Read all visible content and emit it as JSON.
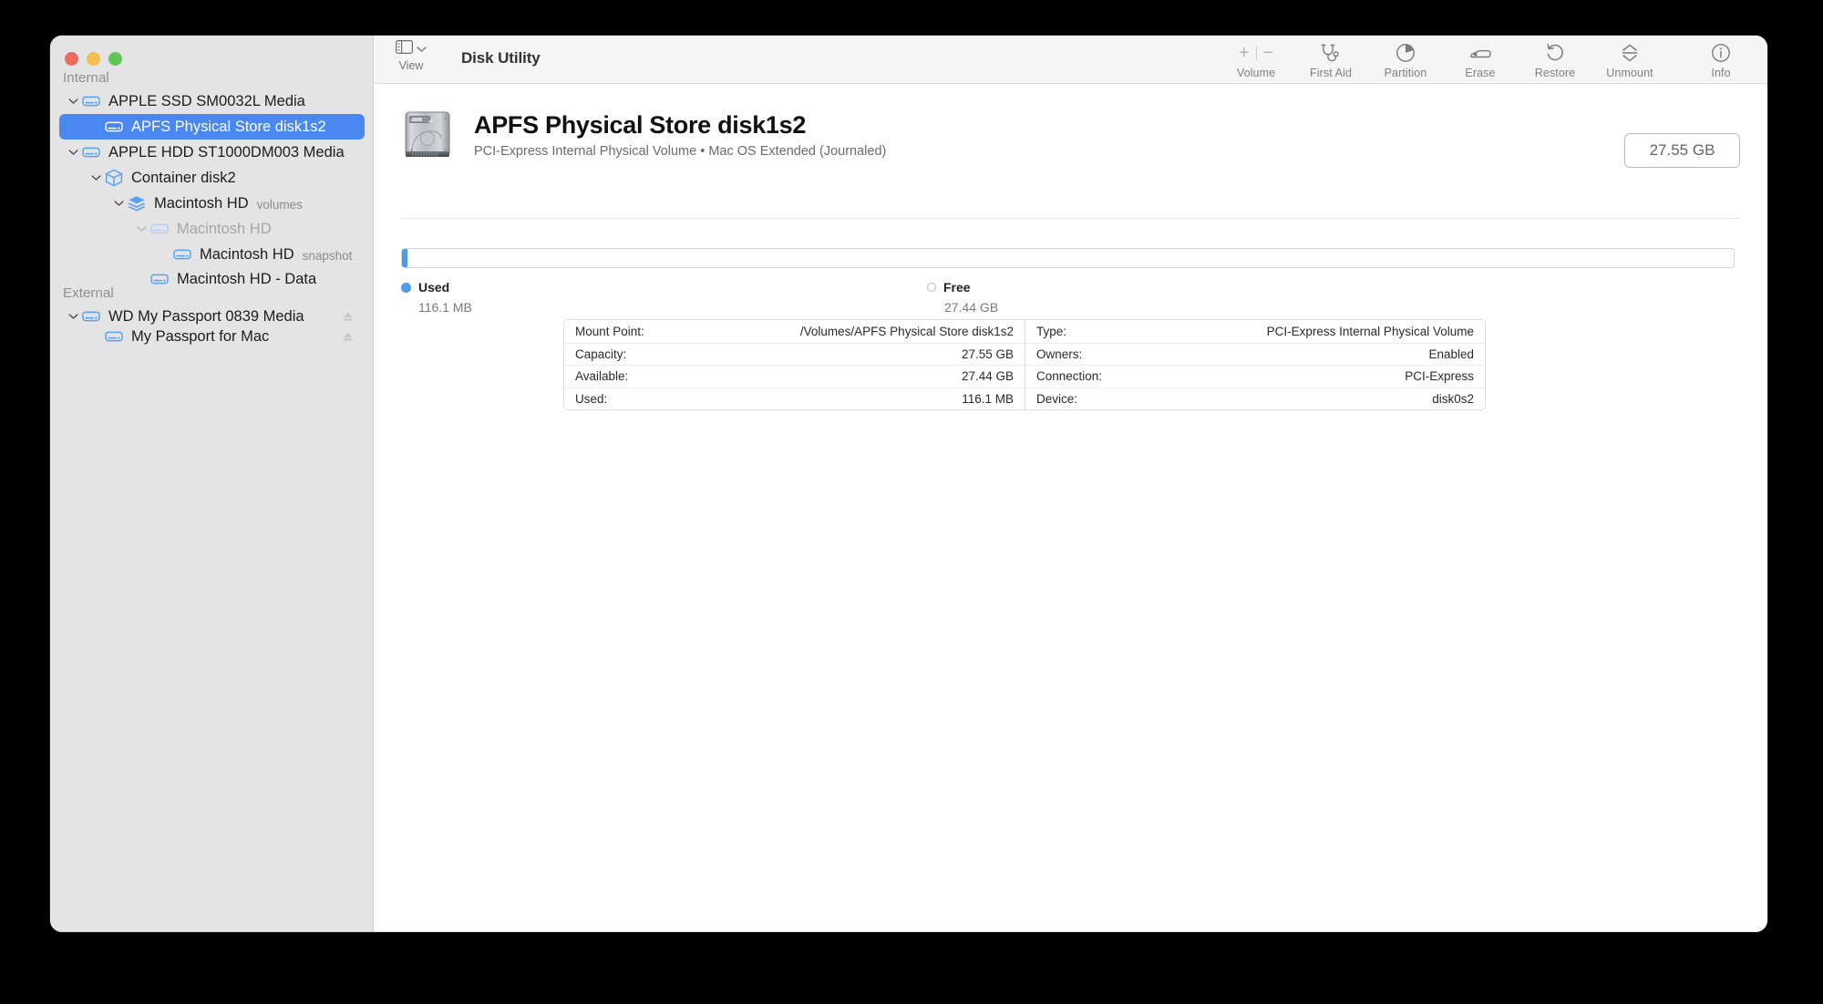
{
  "window": {
    "title": "Disk Utility",
    "traffic_lights": [
      "close",
      "minimize",
      "zoom"
    ]
  },
  "toolbar": {
    "view": {
      "label": "View",
      "icon": "sidebar-toggle-icon"
    },
    "items": [
      {
        "id": "volume",
        "label": "Volume",
        "icon": "plus-minus-icon",
        "disabled": true
      },
      {
        "id": "first-aid",
        "label": "First Aid",
        "icon": "stethoscope-icon",
        "disabled": false
      },
      {
        "id": "partition",
        "label": "Partition",
        "icon": "pie-chart-icon",
        "disabled": false
      },
      {
        "id": "erase",
        "label": "Erase",
        "icon": "eraser-icon",
        "disabled": false
      },
      {
        "id": "restore",
        "label": "Restore",
        "icon": "undo-arrow-icon",
        "disabled": false
      },
      {
        "id": "unmount",
        "label": "Unmount",
        "icon": "eject-split-icon",
        "disabled": false
      },
      {
        "id": "info",
        "label": "Info",
        "icon": "info-circle-icon",
        "disabled": false
      }
    ]
  },
  "sidebar": {
    "sections": [
      {
        "id": "internal",
        "label": "Internal"
      },
      {
        "id": "external",
        "label": "External"
      }
    ],
    "items": [
      {
        "id": "apple-ssd-media",
        "label": "APPLE SSD SM0032L Media",
        "sub": "",
        "icon": "disk-icon",
        "depth": 0,
        "twisty": "down",
        "selected": false,
        "dim": false,
        "eject": false
      },
      {
        "id": "apfs-physical-store",
        "label": "APFS Physical Store disk1s2",
        "sub": "",
        "icon": "disk-icon",
        "depth": 1,
        "twisty": "none",
        "selected": true,
        "dim": false,
        "eject": false
      },
      {
        "id": "apple-hdd-media",
        "label": "APPLE HDD ST1000DM003 Media",
        "sub": "",
        "icon": "disk-icon",
        "depth": 0,
        "twisty": "down",
        "selected": false,
        "dim": false,
        "eject": false
      },
      {
        "id": "container-disk2",
        "label": "Container disk2",
        "sub": "",
        "icon": "container-icon",
        "depth": 1,
        "twisty": "down",
        "selected": false,
        "dim": false,
        "eject": false
      },
      {
        "id": "macintosh-hd-volumes",
        "label": "Macintosh HD",
        "sub": "volumes",
        "icon": "volumes-icon",
        "depth": 2,
        "twisty": "down",
        "selected": false,
        "dim": false,
        "eject": false
      },
      {
        "id": "macintosh-hd",
        "label": "Macintosh HD",
        "sub": "",
        "icon": "disk-icon",
        "depth": 3,
        "twisty": "down",
        "selected": false,
        "dim": true,
        "eject": false
      },
      {
        "id": "macintosh-hd-snapshot",
        "label": "Macintosh HD",
        "sub": "snapshot",
        "icon": "disk-icon",
        "depth": 4,
        "twisty": "none",
        "selected": false,
        "dim": false,
        "eject": false
      },
      {
        "id": "macintosh-hd-data",
        "label": "Macintosh HD - Data",
        "sub": "",
        "icon": "disk-icon",
        "depth": 3,
        "twisty": "none",
        "selected": false,
        "dim": false,
        "eject": false
      },
      {
        "id": "wd-my-passport-media",
        "label": "WD My Passport 0839 Media",
        "sub": "",
        "icon": "disk-icon",
        "depth": 0,
        "twisty": "down",
        "selected": false,
        "dim": false,
        "eject": true
      },
      {
        "id": "my-passport-for-mac",
        "label": "My Passport for Mac",
        "sub": "",
        "icon": "disk-icon",
        "depth": 1,
        "twisty": "none",
        "selected": false,
        "dim": false,
        "eject": true
      }
    ]
  },
  "detail": {
    "title": "APFS Physical Store disk1s2",
    "subtitle": "PCI-Express Internal Physical Volume • Mac OS Extended (Journaled)",
    "capacity_badge": "27.55 GB",
    "usage": {
      "used_percent": 0.41,
      "legend": [
        {
          "id": "used",
          "name": "Used",
          "value": "116.1 MB",
          "color": "#4a9ce9",
          "filled": true
        },
        {
          "id": "free",
          "name": "Free",
          "value": "27.44 GB",
          "color": "#ffffff",
          "filled": false
        }
      ]
    },
    "info_left": [
      {
        "key": "Mount Point:",
        "value": "/Volumes/APFS Physical Store disk1s2"
      },
      {
        "key": "Capacity:",
        "value": "27.55 GB"
      },
      {
        "key": "Available:",
        "value": "27.44 GB"
      },
      {
        "key": "Used:",
        "value": "116.1 MB"
      }
    ],
    "info_right": [
      {
        "key": "Type:",
        "value": "PCI-Express Internal Physical Volume"
      },
      {
        "key": "Owners:",
        "value": "Enabled"
      },
      {
        "key": "Connection:",
        "value": "PCI-Express"
      },
      {
        "key": "Device:",
        "value": "disk0s2"
      }
    ]
  },
  "colors": {
    "selection_blue": "#4a87f0",
    "used_blue": "#4a9ce9",
    "sidebar_bg": "#e4e4e4",
    "toolbar_bg": "#f5f5f5",
    "icon_blue": "#57a0f5"
  }
}
